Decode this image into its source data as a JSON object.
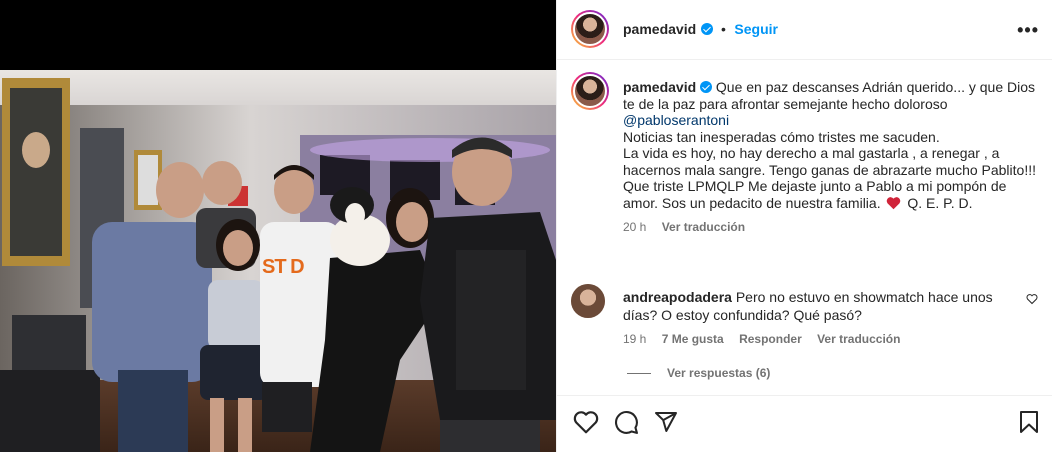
{
  "post": {
    "author": "pamedavid",
    "follow_label": "Seguir",
    "more_label": "•••"
  },
  "caption": {
    "author": "pamedavid",
    "text_1": "Que en paz descanses Adrián querido... y que Dios te de la paz para afrontar semejante hecho doloroso",
    "mention": "@pabloserantoni",
    "text_2": "Noticias tan inesperadas cómo tristes me sacuden.",
    "text_3": "La vida es hoy, no hay derecho a mal gastarla , a renegar , a hacernos mala sangre. Tengo ganas de abrazarte mucho Pablito!!! Que triste LPMQLP Me dejaste junto a Pablo a mi pompón de amor. Sos un pedacito de nuestra familia.",
    "text_4": "Q. E. P. D.",
    "time": "20 h",
    "translate": "Ver traducción"
  },
  "comment": {
    "author": "andreapodadera",
    "text": "Pero no estuvo en showmatch hace unos días? O estoy confundida? Qué pasó?",
    "time": "19 h",
    "likes": "7 Me gusta",
    "reply": "Responder",
    "translate": "Ver traducción",
    "view_replies": "Ver respuestas (6)"
  },
  "photo": {
    "shirt_text": "ST D"
  },
  "colors": {
    "accent": "#0095f6",
    "verified": "#0095f6",
    "mention": "#00376b",
    "heart": "#e0245e"
  }
}
